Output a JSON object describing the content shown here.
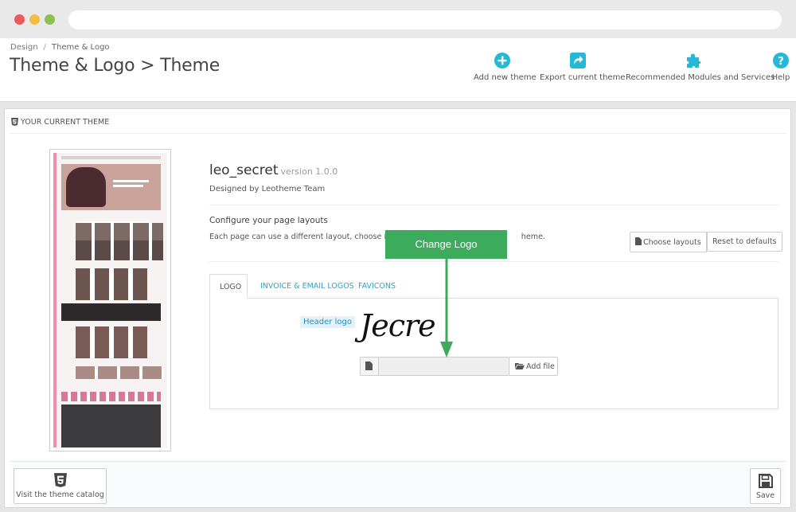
{
  "breadcrumb": {
    "parent": "Design",
    "separator": "/",
    "current": "Theme & Logo"
  },
  "page_title": "Theme & Logo > Theme",
  "toolbar": {
    "add_new_theme": "Add new theme",
    "export_current_theme": "Export current theme",
    "recommended": "Recommended Modules and Services",
    "help": "Help",
    "accent_color": "#25b9d7"
  },
  "panel": {
    "heading": "YOUR CURRENT THEME"
  },
  "theme": {
    "name": "leo_secret",
    "version": "version 1.0.0",
    "designed_by": "Designed by Leotheme Team"
  },
  "layouts": {
    "title": "Configure your page layouts",
    "description": "Each page can use a different layout, choose it ar",
    "description_tail": "heme.",
    "choose_button": "Choose layouts",
    "reset_button": "Reset to defaults"
  },
  "tabs": [
    {
      "label": "LOGO",
      "active": true
    },
    {
      "label": "INVOICE & EMAIL LOGOS",
      "active": false
    },
    {
      "label": "FAVICONS",
      "active": false
    }
  ],
  "logo_tab": {
    "label": "Header logo",
    "logo_text": "Jecre",
    "file_value": "",
    "add_file_button": "Add file"
  },
  "callout": {
    "text": "Change Logo",
    "color": "#3cab5c"
  },
  "footer": {
    "catalog_button": "Visit the theme catalog",
    "save_button": "Save"
  }
}
